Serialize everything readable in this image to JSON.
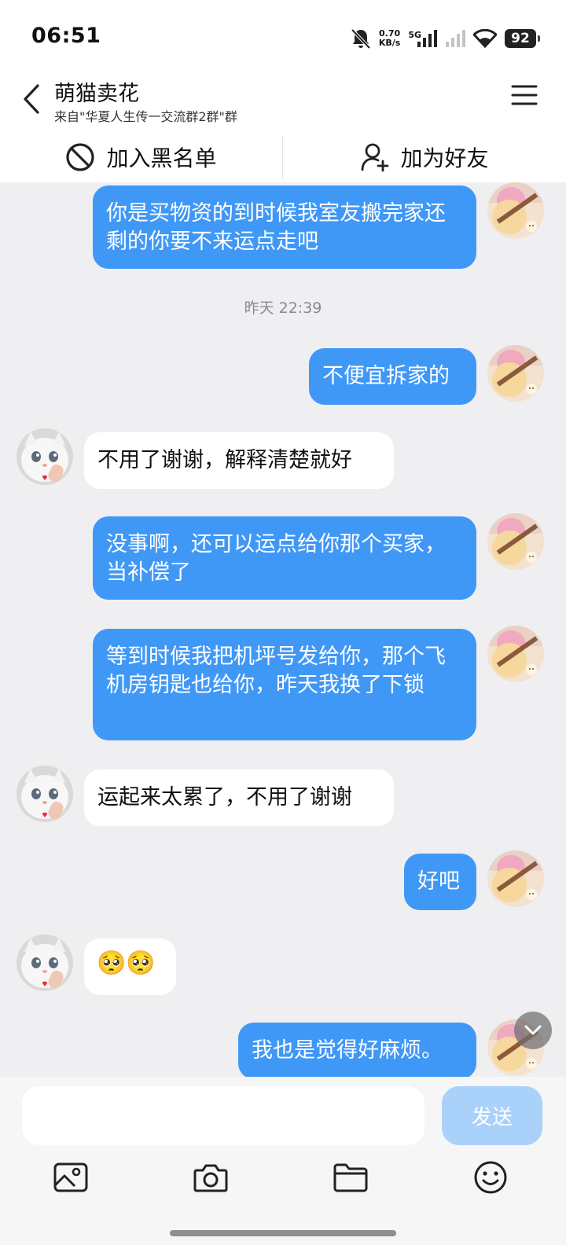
{
  "status": {
    "time": "06:51",
    "speed_value": "0.70",
    "speed_unit": "KB/s",
    "net": "5G",
    "battery": "92"
  },
  "header": {
    "title": "萌猫卖花",
    "subtitle": "来自\"华夏人生传一交流群2群\"群"
  },
  "actions": {
    "block_label": "加入黑名单",
    "add_friend_label": "加为好友"
  },
  "chat": {
    "m1": "你是买物资的到时候我室友搬完家还剩的你要不来运点走吧",
    "timestamp": "昨天 22:39",
    "m2": "不便宜拆家的",
    "m3": "不用了谢谢，解释清楚就好",
    "m4": "没事啊，还可以运点给你那个买家，当补偿了",
    "m5": "等到时候我把机坪号发给你，那个飞机房钥匙也给你，昨天我换了下锁",
    "m6": "运起来太累了，不用了谢谢",
    "m7": "好吧",
    "m8_emoji": "🥺🥺",
    "m9": "我也是觉得好麻烦。"
  },
  "input": {
    "placeholder": "",
    "value": "",
    "send_label": "发送"
  },
  "toolbar": [
    "image-icon",
    "camera-icon",
    "folder-icon",
    "emoji-icon"
  ],
  "colors": {
    "my_bubble": "#4098f6",
    "other_bubble": "#ffffff",
    "chat_bg": "#efeff1",
    "send_disabled": "#a9d1fa"
  }
}
